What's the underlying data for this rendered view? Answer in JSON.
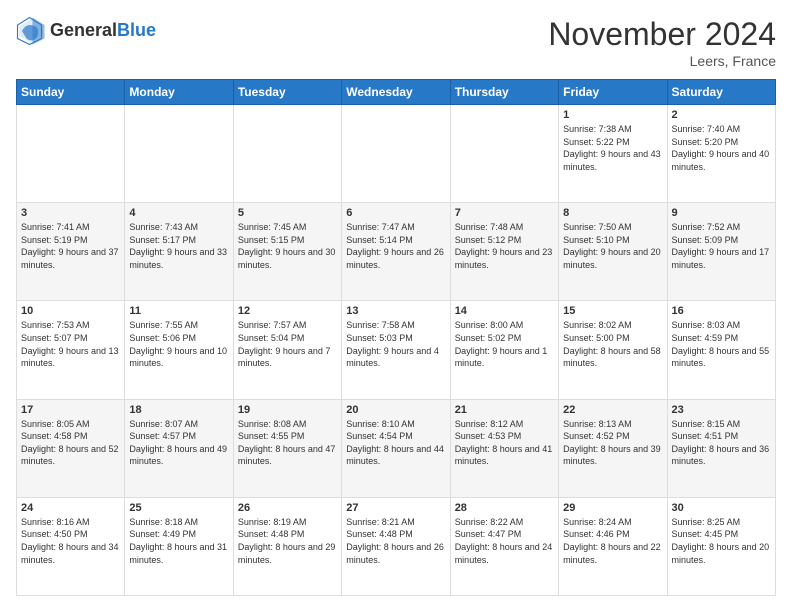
{
  "header": {
    "logo_general": "General",
    "logo_blue": "Blue",
    "month_title": "November 2024",
    "location": "Leers, France"
  },
  "days_of_week": [
    "Sunday",
    "Monday",
    "Tuesday",
    "Wednesday",
    "Thursday",
    "Friday",
    "Saturday"
  ],
  "weeks": [
    [
      {
        "day": "",
        "info": ""
      },
      {
        "day": "",
        "info": ""
      },
      {
        "day": "",
        "info": ""
      },
      {
        "day": "",
        "info": ""
      },
      {
        "day": "",
        "info": ""
      },
      {
        "day": "1",
        "info": "Sunrise: 7:38 AM\nSunset: 5:22 PM\nDaylight: 9 hours and 43 minutes."
      },
      {
        "day": "2",
        "info": "Sunrise: 7:40 AM\nSunset: 5:20 PM\nDaylight: 9 hours and 40 minutes."
      }
    ],
    [
      {
        "day": "3",
        "info": "Sunrise: 7:41 AM\nSunset: 5:19 PM\nDaylight: 9 hours and 37 minutes."
      },
      {
        "day": "4",
        "info": "Sunrise: 7:43 AM\nSunset: 5:17 PM\nDaylight: 9 hours and 33 minutes."
      },
      {
        "day": "5",
        "info": "Sunrise: 7:45 AM\nSunset: 5:15 PM\nDaylight: 9 hours and 30 minutes."
      },
      {
        "day": "6",
        "info": "Sunrise: 7:47 AM\nSunset: 5:14 PM\nDaylight: 9 hours and 26 minutes."
      },
      {
        "day": "7",
        "info": "Sunrise: 7:48 AM\nSunset: 5:12 PM\nDaylight: 9 hours and 23 minutes."
      },
      {
        "day": "8",
        "info": "Sunrise: 7:50 AM\nSunset: 5:10 PM\nDaylight: 9 hours and 20 minutes."
      },
      {
        "day": "9",
        "info": "Sunrise: 7:52 AM\nSunset: 5:09 PM\nDaylight: 9 hours and 17 minutes."
      }
    ],
    [
      {
        "day": "10",
        "info": "Sunrise: 7:53 AM\nSunset: 5:07 PM\nDaylight: 9 hours and 13 minutes."
      },
      {
        "day": "11",
        "info": "Sunrise: 7:55 AM\nSunset: 5:06 PM\nDaylight: 9 hours and 10 minutes."
      },
      {
        "day": "12",
        "info": "Sunrise: 7:57 AM\nSunset: 5:04 PM\nDaylight: 9 hours and 7 minutes."
      },
      {
        "day": "13",
        "info": "Sunrise: 7:58 AM\nSunset: 5:03 PM\nDaylight: 9 hours and 4 minutes."
      },
      {
        "day": "14",
        "info": "Sunrise: 8:00 AM\nSunset: 5:02 PM\nDaylight: 9 hours and 1 minute."
      },
      {
        "day": "15",
        "info": "Sunrise: 8:02 AM\nSunset: 5:00 PM\nDaylight: 8 hours and 58 minutes."
      },
      {
        "day": "16",
        "info": "Sunrise: 8:03 AM\nSunset: 4:59 PM\nDaylight: 8 hours and 55 minutes."
      }
    ],
    [
      {
        "day": "17",
        "info": "Sunrise: 8:05 AM\nSunset: 4:58 PM\nDaylight: 8 hours and 52 minutes."
      },
      {
        "day": "18",
        "info": "Sunrise: 8:07 AM\nSunset: 4:57 PM\nDaylight: 8 hours and 49 minutes."
      },
      {
        "day": "19",
        "info": "Sunrise: 8:08 AM\nSunset: 4:55 PM\nDaylight: 8 hours and 47 minutes."
      },
      {
        "day": "20",
        "info": "Sunrise: 8:10 AM\nSunset: 4:54 PM\nDaylight: 8 hours and 44 minutes."
      },
      {
        "day": "21",
        "info": "Sunrise: 8:12 AM\nSunset: 4:53 PM\nDaylight: 8 hours and 41 minutes."
      },
      {
        "day": "22",
        "info": "Sunrise: 8:13 AM\nSunset: 4:52 PM\nDaylight: 8 hours and 39 minutes."
      },
      {
        "day": "23",
        "info": "Sunrise: 8:15 AM\nSunset: 4:51 PM\nDaylight: 8 hours and 36 minutes."
      }
    ],
    [
      {
        "day": "24",
        "info": "Sunrise: 8:16 AM\nSunset: 4:50 PM\nDaylight: 8 hours and 34 minutes."
      },
      {
        "day": "25",
        "info": "Sunrise: 8:18 AM\nSunset: 4:49 PM\nDaylight: 8 hours and 31 minutes."
      },
      {
        "day": "26",
        "info": "Sunrise: 8:19 AM\nSunset: 4:48 PM\nDaylight: 8 hours and 29 minutes."
      },
      {
        "day": "27",
        "info": "Sunrise: 8:21 AM\nSunset: 4:48 PM\nDaylight: 8 hours and 26 minutes."
      },
      {
        "day": "28",
        "info": "Sunrise: 8:22 AM\nSunset: 4:47 PM\nDaylight: 8 hours and 24 minutes."
      },
      {
        "day": "29",
        "info": "Sunrise: 8:24 AM\nSunset: 4:46 PM\nDaylight: 8 hours and 22 minutes."
      },
      {
        "day": "30",
        "info": "Sunrise: 8:25 AM\nSunset: 4:45 PM\nDaylight: 8 hours and 20 minutes."
      }
    ]
  ]
}
